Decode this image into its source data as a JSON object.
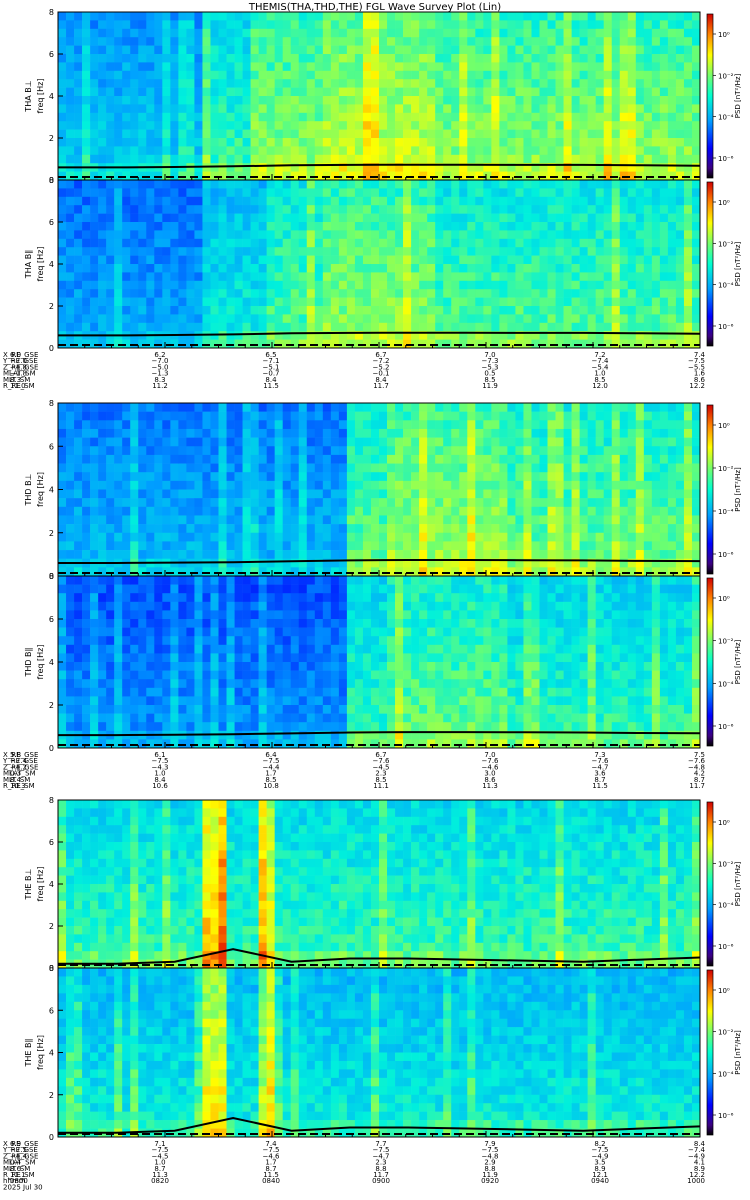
{
  "title": "THEMIS(THA,THD,THE) FGL Wave Survey Plot (Lin)",
  "date_label": "2025 Jul 30",
  "colors": {
    "background": "#ffffff",
    "axis": "#000000",
    "trace": "#000000",
    "colormap": [
      "#00007f",
      "#0000ff",
      "#007fff",
      "#00ffff",
      "#7fff7f",
      "#ffff00",
      "#ff7f00",
      "#ff0000",
      "#7f0000"
    ]
  },
  "chart_data": [
    {
      "type": "heatmap",
      "probe": "THA",
      "panels": [
        {
          "label": "THA B⊥",
          "ylabel": "freq [Hz]",
          "ylim": [
            0,
            8
          ],
          "yticks": [
            "0",
            "2",
            "4",
            "6",
            "8"
          ],
          "colorbar": {
            "label": "PSD [nT²/Hz]",
            "ticks": [
              "10⁰",
              "10⁻²",
              "10⁻⁴",
              "10⁻⁶"
            ],
            "scale": "log"
          },
          "trace_freq_hz": [
            0.6,
            0.6,
            0.62,
            0.65,
            0.7,
            0.72,
            0.73,
            0.73,
            0.72,
            0.72,
            0.7,
            0.68
          ]
        },
        {
          "label": "THA B∥",
          "ylabel": "freq [Hz]",
          "ylim": [
            0,
            8
          ],
          "yticks": [
            "0",
            "2",
            "4",
            "6",
            "8"
          ],
          "colorbar": {
            "label": "PSD [nT²/Hz]",
            "ticks": [
              "10⁰",
              "10⁻²",
              "10⁻⁴",
              "10⁻⁶"
            ],
            "scale": "log"
          },
          "trace_freq_hz": [
            0.6,
            0.6,
            0.62,
            0.65,
            0.7,
            0.72,
            0.73,
            0.73,
            0.72,
            0.72,
            0.7,
            0.68
          ]
        }
      ],
      "ephemeris": {
        "labels": [
          "X_RE_GSE",
          "Y_RE_GSE",
          "Z_RE_GSE",
          "MLAT_SM",
          "MLT_SM",
          "R_RE_SM"
        ],
        "columns": [
          [
            "6.0",
            "−7.0",
            "−4.8",
            "−1.8",
            "8.3",
            "11.0"
          ],
          [
            "6.2",
            "−7.0",
            "−5.0",
            "−1.3",
            "8.3",
            "11.2"
          ],
          [
            "6.5",
            "−7.1",
            "−5.1",
            "−0.7",
            "8.4",
            "11.5"
          ],
          [
            "6.7",
            "−7.2",
            "−5.2",
            "−0.1",
            "8.4",
            "11.7"
          ],
          [
            "7.0",
            "−7.3",
            "−5.3",
            "0.5",
            "8.5",
            "11.9"
          ],
          [
            "7.2",
            "−7.4",
            "−5.4",
            "1.0",
            "8.5",
            "12.0"
          ],
          [
            "7.4",
            "−7.5",
            "−5.5",
            "1.6",
            "8.6",
            "12.2"
          ]
        ]
      }
    },
    {
      "type": "heatmap",
      "probe": "THD",
      "panels": [
        {
          "label": "THD B⊥",
          "ylabel": "freq [Hz]",
          "ylim": [
            0,
            8
          ],
          "yticks": [
            "0",
            "2",
            "4",
            "6",
            "8"
          ],
          "colorbar": {
            "label": "PSD [nT²/Hz]",
            "ticks": [
              "10⁰",
              "10⁻²",
              "10⁻⁴",
              "10⁻⁶"
            ],
            "scale": "log"
          },
          "trace_freq_hz": [
            0.6,
            0.6,
            0.62,
            0.64,
            0.68,
            0.72,
            0.74,
            0.74,
            0.73,
            0.72,
            0.7,
            0.69
          ]
        },
        {
          "label": "THD B∥",
          "ylabel": "freq [Hz]",
          "ylim": [
            0,
            8
          ],
          "yticks": [
            "0",
            "2",
            "4",
            "6",
            "8"
          ],
          "colorbar": {
            "label": "PSD [nT²/Hz]",
            "ticks": [
              "10⁰",
              "10⁻²",
              "10⁻⁴",
              "10⁻⁶"
            ],
            "scale": "log"
          },
          "trace_freq_hz": [
            0.6,
            0.6,
            0.62,
            0.64,
            0.68,
            0.72,
            0.74,
            0.74,
            0.73,
            0.72,
            0.7,
            0.69
          ]
        }
      ],
      "ephemeris": {
        "labels": [
          "X_RE_GSE",
          "Y_RE_GSE",
          "Z_RE_GSE",
          "MLAT_SM",
          "MLT_SM",
          "R_RE_SM"
        ],
        "columns": [
          [
            "5.8",
            "−7.4",
            "−4.2",
            "0.3",
            "8.4",
            "10.3"
          ],
          [
            "6.1",
            "−7.5",
            "−4.3",
            "1.0",
            "8.4",
            "10.6"
          ],
          [
            "6.4",
            "−7.5",
            "−4.4",
            "1.7",
            "8.5",
            "10.8"
          ],
          [
            "6.7",
            "−7.6",
            "−4.5",
            "2.3",
            "8.5",
            "11.1"
          ],
          [
            "7.0",
            "−7.6",
            "−4.6",
            "3.0",
            "8.6",
            "11.3"
          ],
          [
            "7.3",
            "−7.6",
            "−4.7",
            "3.6",
            "8.7",
            "11.5"
          ],
          [
            "7.5",
            "−7.6",
            "−4.8",
            "4.2",
            "8.7",
            "11.7"
          ]
        ]
      }
    },
    {
      "type": "heatmap",
      "probe": "THE",
      "panels": [
        {
          "label": "THE B⊥",
          "ylabel": "freq [Hz]",
          "ylim": [
            0,
            8
          ],
          "yticks": [
            "0",
            "2",
            "4",
            "6",
            "8"
          ],
          "colorbar": {
            "label": "PSD [nT²/Hz]",
            "ticks": [
              "10⁰",
              "10⁻²",
              "10⁻⁴",
              "10⁻⁶"
            ],
            "scale": "log"
          },
          "trace_freq_hz": [
            0.2,
            0.2,
            0.3,
            0.9,
            0.3,
            0.45,
            0.45,
            0.4,
            0.35,
            0.3,
            0.4,
            0.5
          ]
        },
        {
          "label": "THE B∥",
          "ylabel": "freq [Hz]",
          "ylim": [
            0,
            8
          ],
          "yticks": [
            "0",
            "2",
            "4",
            "6",
            "8"
          ],
          "colorbar": {
            "label": "PSD [nT²/Hz]",
            "ticks": [
              "10⁰",
              "10⁻²",
              "10⁻⁴",
              "10⁻⁶"
            ],
            "scale": "log"
          },
          "trace_freq_hz": [
            0.2,
            0.2,
            0.3,
            0.9,
            0.3,
            0.45,
            0.45,
            0.4,
            0.35,
            0.3,
            0.4,
            0.5
          ]
        }
      ],
      "ephemeris": {
        "labels": [
          "X_RE_GSE",
          "Y_RE_GSE",
          "Z_RE_GSE",
          "MLAT_SM",
          "MLT_SM",
          "R_RE_SM",
          "hhmm"
        ],
        "columns": [
          [
            "6.9",
            "−7.5",
            "−4.4",
            "0.4",
            "8.6",
            "11.1",
            "0800"
          ],
          [
            "7.1",
            "−7.5",
            "−4.5",
            "1.0",
            "8.7",
            "11.3",
            "0820"
          ],
          [
            "7.4",
            "−7.5",
            "−4.6",
            "1.7",
            "8.7",
            "11.5",
            "0840"
          ],
          [
            "7.7",
            "−7.5",
            "−4.7",
            "2.3",
            "8.8",
            "11.7",
            "0900"
          ],
          [
            "7.9",
            "−7.5",
            "−4.8",
            "2.9",
            "8.8",
            "11.9",
            "0920"
          ],
          [
            "8.2",
            "−7.5",
            "−4.9",
            "3.5",
            "8.9",
            "12.1",
            "0940"
          ],
          [
            "8.4",
            "−7.4",
            "−4.9",
            "4.1",
            "8.9",
            "12.2",
            "1000"
          ]
        ]
      }
    }
  ]
}
